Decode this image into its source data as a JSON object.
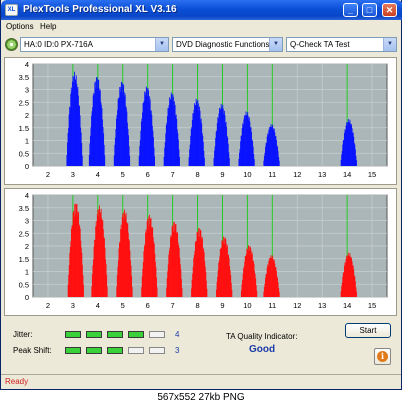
{
  "window": {
    "app_icon": "XL",
    "title": "PlexTools Professional XL V3.16",
    "minimize": "_",
    "maximize": "□",
    "close": "✕"
  },
  "menu": {
    "items": [
      "Options",
      "Help"
    ]
  },
  "toolbar": {
    "drive_icon": "disc-drive-icon",
    "drive": "HA:0 ID:0  PX-716A",
    "function": "DVD Diagnostic Functions",
    "test": "Q-Check TA Test",
    "arrow": "▼"
  },
  "colors": {
    "top_series": "#0a14ff",
    "bottom_series": "#ff1010",
    "marker": "#22cc22",
    "plot_bg": "#aab6b8"
  },
  "chart_data": [
    {
      "type": "bar",
      "xlim": [
        1.4,
        15.6
      ],
      "ylim": [
        0,
        4
      ],
      "x_ticks": [
        "2",
        "3",
        "4",
        "5",
        "6",
        "7",
        "8",
        "9",
        "10",
        "11",
        "12",
        "13",
        "14",
        "15"
      ],
      "y_ticks": [
        "0",
        "0.5",
        "1",
        "1.5",
        "2",
        "2.5",
        "3",
        "3.5",
        "4"
      ],
      "markers": [
        3,
        4,
        5,
        6,
        7,
        8,
        9,
        10,
        11,
        14
      ],
      "peaks": [
        {
          "x": 3.05,
          "h": 3.7
        },
        {
          "x": 3.95,
          "h": 3.55
        },
        {
          "x": 4.95,
          "h": 3.35
        },
        {
          "x": 5.95,
          "h": 3.15
        },
        {
          "x": 6.95,
          "h": 2.9
        },
        {
          "x": 7.95,
          "h": 2.65
        },
        {
          "x": 8.95,
          "h": 2.45
        },
        {
          "x": 9.95,
          "h": 2.15
        },
        {
          "x": 10.95,
          "h": 1.65
        },
        {
          "x": 14.05,
          "h": 1.85
        }
      ],
      "grid": true
    },
    {
      "type": "bar",
      "xlim": [
        1.4,
        15.6
      ],
      "ylim": [
        0,
        4
      ],
      "x_ticks": [
        "2",
        "3",
        "4",
        "5",
        "6",
        "7",
        "8",
        "9",
        "10",
        "11",
        "12",
        "13",
        "14",
        "15"
      ],
      "y_ticks": [
        "0",
        "0.5",
        "1",
        "1.5",
        "2",
        "2.5",
        "3",
        "3.5",
        "4"
      ],
      "markers": [
        3,
        4,
        5,
        6,
        7,
        8,
        9,
        10,
        11,
        14
      ],
      "peaks": [
        {
          "x": 3.1,
          "h": 3.75
        },
        {
          "x": 4.05,
          "h": 3.6
        },
        {
          "x": 5.05,
          "h": 3.45
        },
        {
          "x": 6.05,
          "h": 3.25
        },
        {
          "x": 7.05,
          "h": 3.0
        },
        {
          "x": 8.05,
          "h": 2.75
        },
        {
          "x": 9.05,
          "h": 2.4
        },
        {
          "x": 10.05,
          "h": 2.05
        },
        {
          "x": 10.95,
          "h": 1.65
        },
        {
          "x": 14.05,
          "h": 1.75
        }
      ],
      "grid": true
    }
  ],
  "metrics": {
    "jitter": {
      "label": "Jitter:",
      "value": "4",
      "level": 4,
      "max": 5
    },
    "peak_shift": {
      "label": "Peak Shift:",
      "value": "3",
      "level": 3,
      "max": 5
    }
  },
  "ta_quality": {
    "label": "TA Quality Indicator:",
    "value": "Good"
  },
  "start_button": "Start",
  "info_icon": "i",
  "status": "Ready",
  "caption": "567x552 27kb PNG"
}
